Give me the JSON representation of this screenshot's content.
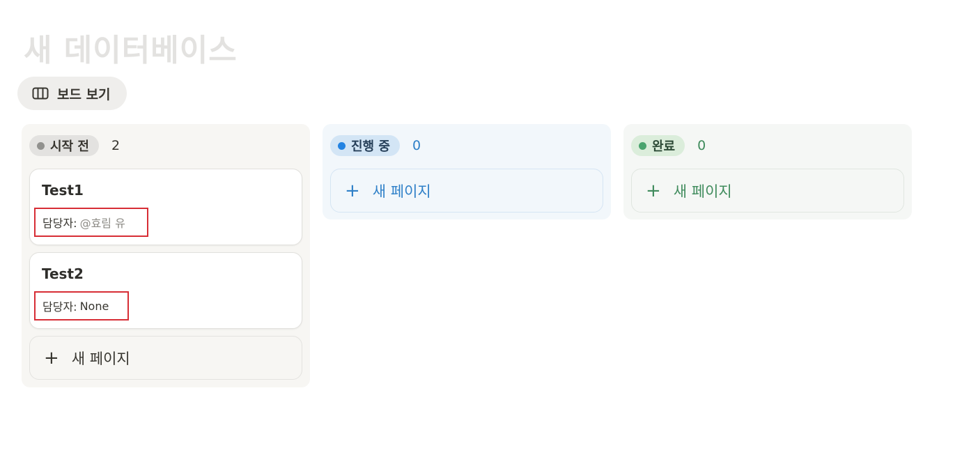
{
  "page": {
    "title": "새 데이터베이스"
  },
  "view": {
    "label": "보드 보기",
    "icon": "board-columns-icon"
  },
  "columns": [
    {
      "status": "시작 전",
      "count": "2",
      "pill_bg": "#e3e2e0",
      "dot_color": "#91918e",
      "text_color": "#37352f",
      "cards": [
        {
          "title": "Test1",
          "prop_label": "담당자:",
          "prop_value": "@효림 유"
        },
        {
          "title": "Test2",
          "prop_label": "담당자:",
          "prop_value": "None"
        }
      ],
      "new_page": {
        "plus": "+",
        "label": "새 페이지"
      }
    },
    {
      "status": "진행 중",
      "count": "0",
      "pill_bg": "#d3e5f5",
      "dot_color": "#2383e2",
      "text_color": "#2f80c8",
      "cards": [],
      "new_page": {
        "plus": "+",
        "label": "새 페이지"
      }
    },
    {
      "status": "완료",
      "count": "0",
      "pill_bg": "#dbeddb",
      "dot_color": "#4aa46e",
      "text_color": "#3f8b5c",
      "cards": [],
      "new_page": {
        "plus": "+",
        "label": "새 페이지"
      }
    }
  ],
  "colors": {
    "highlight_box": "#d72d35"
  }
}
